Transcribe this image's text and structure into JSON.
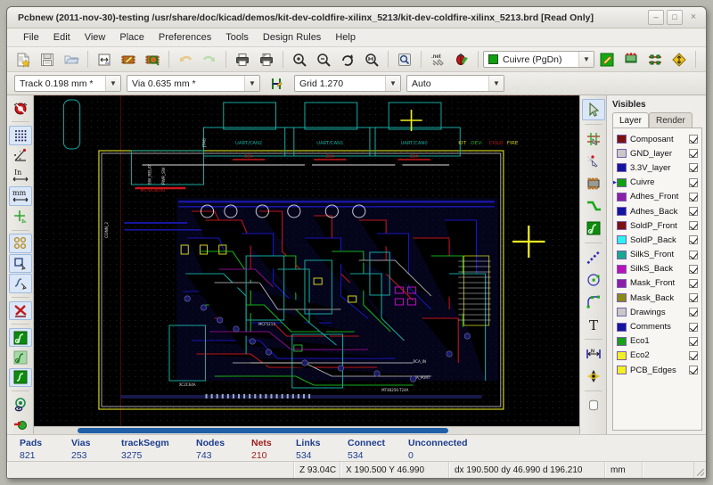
{
  "window": {
    "title": "Pcbnew (2011-nov-30)-testing /usr/share/doc/kicad/demos/kit-dev-coldfire-xilinx_5213/kit-dev-coldfire-xilinx_5213.brd [Read Only]",
    "minimize_label": "–",
    "maximize_label": "□",
    "close_label": "×"
  },
  "menu": {
    "items": [
      {
        "label": "File"
      },
      {
        "label": "Edit"
      },
      {
        "label": "View"
      },
      {
        "label": "Place"
      },
      {
        "label": "Preferences"
      },
      {
        "label": "Tools"
      },
      {
        "label": "Design Rules"
      },
      {
        "label": "Help"
      }
    ]
  },
  "toolbar": {
    "buttons": [
      {
        "name": "new-board-icon",
        "title": "New board"
      },
      {
        "name": "save-board-icon",
        "title": "Save board"
      },
      {
        "name": "open-board-icon",
        "title": "Open board"
      },
      {
        "name": "page-settings-icon",
        "title": "Page settings"
      },
      {
        "name": "open-module-editor-icon",
        "title": "Open module editor"
      },
      {
        "name": "open-module-viewer-icon",
        "title": "Open module viewer"
      },
      {
        "name": "undo-icon",
        "title": "Undo"
      },
      {
        "name": "redo-icon",
        "title": "Redo"
      },
      {
        "name": "print-board-icon",
        "title": "Print board"
      },
      {
        "name": "plot-icon",
        "title": "Plot"
      },
      {
        "name": "zoom-in-icon",
        "title": "Zoom in"
      },
      {
        "name": "zoom-out-icon",
        "title": "Zoom out"
      },
      {
        "name": "zoom-redraw-icon",
        "title": "Redraw view"
      },
      {
        "name": "zoom-fit-icon",
        "title": "Zoom auto"
      },
      {
        "name": "find-icon",
        "title": "Find"
      },
      {
        "name": "netlist-icon",
        "title": "Read netlist"
      },
      {
        "name": "drc-icon",
        "title": "Design rules check"
      },
      {
        "name": "mode-track-icon",
        "title": "Mode track"
      },
      {
        "name": "show-ratsnest-icon",
        "title": "Show board ratsnest"
      },
      {
        "name": "hide-tracks-icon",
        "title": "Enable auto delete old track"
      },
      {
        "name": "high-contrast-icon",
        "title": "Show vias in sketch mode"
      }
    ]
  },
  "toolbar2": {
    "track_width": "Track 0.198 mm *",
    "via_size": "Via 0.635 mm *",
    "auto_track_width_icon": "auto-track-width-icon",
    "grid": "Grid 1.270",
    "zoom_mode": "Auto",
    "layer_select": "Cuivre (PgDn)",
    "layer_select_color": "#0ea00e"
  },
  "left_toolbar": {
    "buttons": [
      {
        "name": "drc-off-icon",
        "title": "Disable design rule checking"
      },
      {
        "name": "grid-visibility-icon",
        "title": "Display grid",
        "selected": true
      },
      {
        "name": "polar-coords-icon",
        "title": "Display polar coordinates"
      },
      {
        "name": "units-inch-icon",
        "title": "Units in inches",
        "label": "In"
      },
      {
        "name": "units-mm-icon",
        "title": "Units in millimeters",
        "label": "mm",
        "selected": true
      },
      {
        "name": "cursor-shape-icon",
        "title": "Change cursor shape"
      },
      {
        "name": "show-pads-sketch-icon",
        "title": "Show pads in outline mode",
        "selected": true
      },
      {
        "name": "show-modules-sketch-icon",
        "title": "Show module edges in outline mode",
        "selected": true
      },
      {
        "name": "show-tracks-sketch-icon",
        "title": "Show tracks in outline mode"
      },
      {
        "name": "high-contrast-mode-icon",
        "title": "High contrast display mode",
        "selected": true
      },
      {
        "name": "show-zones-icon",
        "title": "Show filled areas in zones"
      },
      {
        "name": "show-zones-disable-icon",
        "title": "Do not show filled areas in zones"
      },
      {
        "name": "show-zones-outline-icon",
        "title": "Show outlines of filled areas only",
        "selected": true
      },
      {
        "name": "manage-layers-icon",
        "title": "Manage layers and visibility"
      },
      {
        "name": "microwave-tools-icon",
        "title": "Microwave tools"
      }
    ]
  },
  "right_toolbar": {
    "buttons": [
      {
        "name": "cursor-select-icon",
        "title": "Select item",
        "selected": true
      },
      {
        "name": "highlight-net-icon",
        "title": "Highlight net"
      },
      {
        "name": "local-ratsnest-icon",
        "title": "Display local ratsnest"
      },
      {
        "name": "add-module-icon",
        "title": "Add modules"
      },
      {
        "name": "add-track-icon",
        "title": "Add tracks and vias"
      },
      {
        "name": "add-zone-icon",
        "title": "Add filled zones"
      },
      {
        "name": "add-line-icon",
        "title": "Add graphic line or polygon"
      },
      {
        "name": "add-circle-icon",
        "title": "Add graphic circle"
      },
      {
        "name": "add-arc-icon",
        "title": "Add graphic arc"
      },
      {
        "name": "add-text-icon",
        "title": "Add text on copper layers or graphic text"
      },
      {
        "name": "add-dimension-icon",
        "title": "Add dimension"
      },
      {
        "name": "add-mire-icon",
        "title": "Add layer alignment target"
      },
      {
        "name": "delete-icon",
        "title": "Delete item"
      }
    ]
  },
  "layers_panel": {
    "title": "Visibles",
    "tabs": [
      {
        "label": "Layer",
        "active": true
      },
      {
        "label": "Render",
        "active": false
      }
    ],
    "rows": [
      {
        "name": "Composant",
        "color": "#7b1212",
        "checked": true,
        "selected": false
      },
      {
        "name": "GND_layer",
        "color": "#c8c8c8",
        "checked": true,
        "selected": false
      },
      {
        "name": "3.3V_layer",
        "color": "#1414a0",
        "checked": true,
        "selected": false
      },
      {
        "name": "Cuivre",
        "color": "#0ea00e",
        "checked": true,
        "selected": true
      },
      {
        "name": "Adhes_Front",
        "color": "#8b20a8",
        "checked": true,
        "selected": false
      },
      {
        "name": "Adhes_Back",
        "color": "#1414a0",
        "checked": true,
        "selected": false
      },
      {
        "name": "SoldP_Front",
        "color": "#7b1212",
        "checked": true,
        "selected": false
      },
      {
        "name": "SoldP_Back",
        "color": "#2ff0f0",
        "checked": true,
        "selected": false
      },
      {
        "name": "SilkS_Front",
        "color": "#18a890",
        "checked": true,
        "selected": false
      },
      {
        "name": "SilkS_Back",
        "color": "#bb11bb",
        "checked": true,
        "selected": false
      },
      {
        "name": "Mask_Front",
        "color": "#8b20a8",
        "checked": true,
        "selected": false
      },
      {
        "name": "Mask_Back",
        "color": "#8a8a16",
        "checked": true,
        "selected": false
      },
      {
        "name": "Drawings",
        "color": "#c8c8c8",
        "checked": true,
        "selected": false
      },
      {
        "name": "Comments",
        "color": "#1414a0",
        "checked": true,
        "selected": false
      },
      {
        "name": "Eco1",
        "color": "#18a018",
        "checked": true,
        "selected": false
      },
      {
        "name": "Eco2",
        "color": "#f0f022",
        "checked": true,
        "selected": false
      },
      {
        "name": "PCB_Edges",
        "color": "#f0f022",
        "checked": true,
        "selected": false
      }
    ]
  },
  "stats": [
    {
      "key": "Pads",
      "value": "821",
      "red": false
    },
    {
      "key": "Vias",
      "value": "253",
      "red": false
    },
    {
      "key": "trackSegm",
      "value": "3275",
      "red": false
    },
    {
      "key": "Nodes",
      "value": "743",
      "red": false
    },
    {
      "key": "Nets",
      "value": "210",
      "red": true
    },
    {
      "key": "Links",
      "value": "534",
      "red": false
    },
    {
      "key": "Connect",
      "value": "534",
      "red": false
    },
    {
      "key": "Unconnected",
      "value": "0",
      "red": false
    }
  ],
  "statusbar": {
    "message": "",
    "zoom": "Z 93.04C",
    "position": "X 190.500  Y 46.990",
    "delta": "dx 190.500  dy 46.990  d 196.210",
    "units": "mm",
    "extra": ""
  },
  "canvas": {
    "background": "#000000",
    "cursor_marker_color": "#f0f022",
    "board_labels": [
      "UART/CAN2",
      "UART/CAN1",
      "UART/CAN0",
      "DB9",
      "DB9",
      "DB9",
      "CONN_2",
      "MC-DC8040",
      "MCF5213",
      "MT48256-T24A",
      "KIT-DEV-COLDFIRE",
      "RCA_PORT"
    ]
  }
}
